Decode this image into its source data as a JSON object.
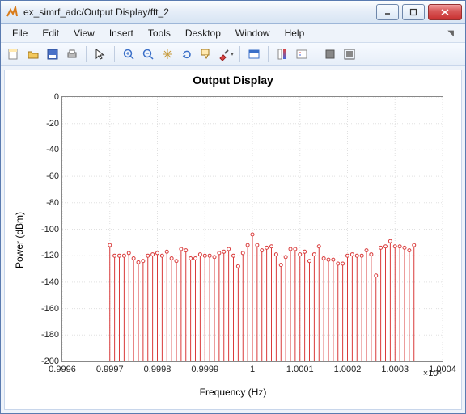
{
  "window": {
    "title": "ex_simrf_adc/Output Display/fft_2"
  },
  "menu": {
    "file": "File",
    "edit": "Edit",
    "view": "View",
    "insert": "Insert",
    "tools": "Tools",
    "desktop": "Desktop",
    "window": "Window",
    "help": "Help"
  },
  "chart": {
    "title": "Output Display",
    "ylabel": "Power (dBm)",
    "xlabel": "Frequency (Hz)",
    "xexp": "×10⁵"
  },
  "chart_data": {
    "type": "stem",
    "title": "Output Display",
    "xlabel": "Frequency (Hz)",
    "ylabel": "Power (dBm)",
    "xlim": [
      0.9996,
      1.0004
    ],
    "ylim": [
      -200,
      0
    ],
    "x_scale_note": "x values are in units of 1e5 Hz (axis ×10^5)",
    "xticks": [
      0.9996,
      0.9997,
      0.9998,
      0.9999,
      1,
      1.0001,
      1.0002,
      1.0003,
      1.0004
    ],
    "yticks": [
      0,
      -20,
      -40,
      -60,
      -80,
      -100,
      -120,
      -140,
      -160,
      -180,
      -200
    ],
    "series": [
      {
        "name": "fft",
        "color": "#d93a3a",
        "marker": "o",
        "x": [
          0.9997,
          0.99971,
          0.99972,
          0.99973,
          0.99974,
          0.99975,
          0.99976,
          0.99977,
          0.99978,
          0.99979,
          0.9998,
          0.99981,
          0.99982,
          0.99983,
          0.99984,
          0.99985,
          0.99986,
          0.99987,
          0.99988,
          0.99989,
          0.9999,
          0.99991,
          0.99992,
          0.99993,
          0.99994,
          0.99995,
          0.99996,
          0.99997,
          0.99998,
          0.99999,
          1.0,
          1.00001,
          1.00002,
          1.00003,
          1.00004,
          1.00005,
          1.00006,
          1.00007,
          1.00008,
          1.00009,
          1.0001,
          1.00011,
          1.00012,
          1.00013,
          1.00014,
          1.00015,
          1.00016,
          1.00017,
          1.00018,
          1.00019,
          1.0002,
          1.00021,
          1.00022,
          1.00023,
          1.00024,
          1.00025,
          1.00026,
          1.00027,
          1.00028,
          1.00029,
          1.0003,
          1.00031,
          1.00032,
          1.00033,
          1.00034
        ],
        "y": [
          -112,
          -120,
          -120,
          -120,
          -118,
          -122,
          -125,
          -124,
          -120,
          -119,
          -118,
          -120,
          -117,
          -122,
          -124,
          -115,
          -116,
          -122,
          -122,
          -119,
          -120,
          -120,
          -121,
          -118,
          -117,
          -115,
          -120,
          -128,
          -118,
          -112,
          -104,
          -112,
          -116,
          -114,
          -113,
          -119,
          -127,
          -121,
          -115,
          -115,
          -119,
          -117,
          -124,
          -119,
          -113,
          -122,
          -123,
          -123,
          -126,
          -126,
          -120,
          -119,
          -120,
          -120,
          -116,
          -119,
          -135,
          -114,
          -113,
          -109,
          -113,
          -113,
          -114,
          -116,
          -112
        ]
      }
    ]
  }
}
